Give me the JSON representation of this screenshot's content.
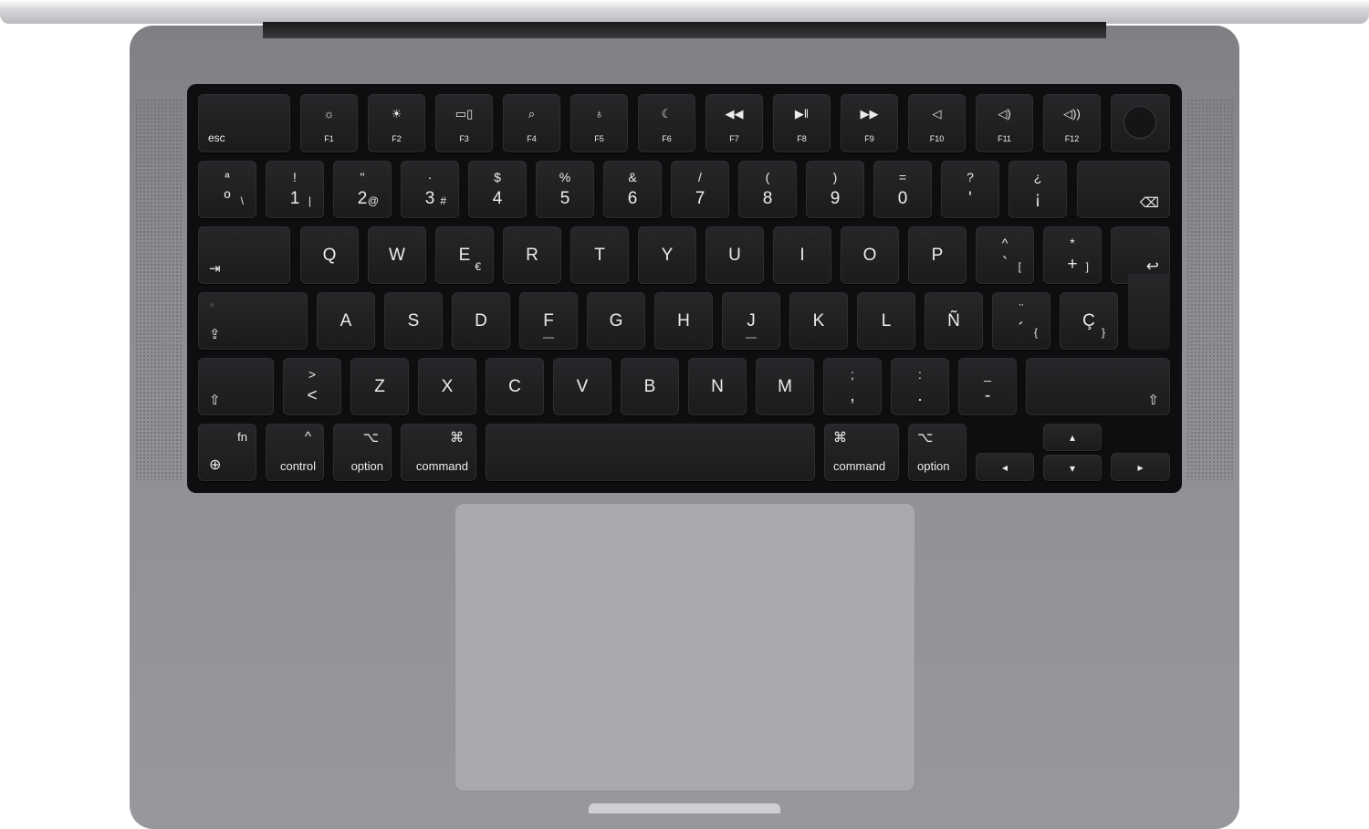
{
  "colors": {
    "chassis": "#8c8d91",
    "keyboard_well": "#0e0e10",
    "key": "#1c1c1e",
    "legend": "#ececec",
    "trackpad": "#a9aaad"
  },
  "keyboard": {
    "rows": [
      {
        "keys": [
          {
            "label": "esc"
          },
          {
            "label": "F1",
            "icon": "brightness-down-icon"
          },
          {
            "label": "F2",
            "icon": "brightness-up-icon"
          },
          {
            "label": "F3",
            "icon": "mission-control-icon"
          },
          {
            "label": "F4",
            "icon": "search-icon"
          },
          {
            "label": "F5",
            "icon": "microphone-icon"
          },
          {
            "label": "F6",
            "icon": "moon-icon"
          },
          {
            "label": "F7",
            "icon": "rewind-icon"
          },
          {
            "label": "F8",
            "icon": "play-pause-icon"
          },
          {
            "label": "F9",
            "icon": "fast-forward-icon"
          },
          {
            "label": "F10",
            "icon": "mute-icon"
          },
          {
            "label": "F11",
            "icon": "volume-down-icon"
          },
          {
            "label": "F12",
            "icon": "volume-up-icon"
          },
          {
            "label": "",
            "icon": "touch-id-icon"
          }
        ]
      },
      {
        "keys": [
          {
            "shift": "ª",
            "label": "º",
            "alt": "\\"
          },
          {
            "shift": "!",
            "label": "1",
            "alt": "|"
          },
          {
            "shift": "\"",
            "label": "2",
            "alt": "@"
          },
          {
            "shift": "·",
            "label": "3",
            "alt": "#"
          },
          {
            "shift": "$",
            "label": "4"
          },
          {
            "shift": "%",
            "label": "5"
          },
          {
            "shift": "&",
            "label": "6"
          },
          {
            "shift": "/",
            "label": "7"
          },
          {
            "shift": "(",
            "label": "8"
          },
          {
            "shift": ")",
            "label": "9"
          },
          {
            "shift": "=",
            "label": "0"
          },
          {
            "shift": "?",
            "label": "'"
          },
          {
            "shift": "¿",
            "label": "¡"
          },
          {
            "label": "",
            "icon": "delete-icon"
          }
        ]
      },
      {
        "keys": [
          {
            "label": "",
            "icon": "tab-icon"
          },
          {
            "label": "Q"
          },
          {
            "label": "W"
          },
          {
            "label": "E",
            "alt": "€"
          },
          {
            "label": "R"
          },
          {
            "label": "T"
          },
          {
            "label": "Y"
          },
          {
            "label": "U"
          },
          {
            "label": "I"
          },
          {
            "label": "O"
          },
          {
            "label": "P"
          },
          {
            "shift": "^",
            "label": "`",
            "alt": "["
          },
          {
            "shift": "*",
            "label": "+",
            "alt": "]"
          }
        ]
      },
      {
        "keys": [
          {
            "label": "",
            "icon": "caps-lock-icon"
          },
          {
            "label": "A"
          },
          {
            "label": "S"
          },
          {
            "label": "D"
          },
          {
            "label": "F"
          },
          {
            "label": "G"
          },
          {
            "label": "H"
          },
          {
            "label": "J"
          },
          {
            "label": "K"
          },
          {
            "label": "L"
          },
          {
            "label": "Ñ"
          },
          {
            "shift": "¨",
            "label": "´",
            "alt": "{"
          },
          {
            "label": "Ç",
            "alt": "}"
          }
        ]
      },
      {
        "keys": [
          {
            "label": "",
            "icon": "shift-icon"
          },
          {
            "shift": ">",
            "label": "<"
          },
          {
            "label": "Z"
          },
          {
            "label": "X"
          },
          {
            "label": "C"
          },
          {
            "label": "V"
          },
          {
            "label": "B"
          },
          {
            "label": "N"
          },
          {
            "label": "M"
          },
          {
            "shift": ";",
            "label": ","
          },
          {
            "shift": ":",
            "label": "."
          },
          {
            "shift": "_",
            "label": "-"
          },
          {
            "label": "",
            "icon": "shift-icon"
          }
        ]
      },
      {
        "keys": [
          {
            "label": "fn",
            "icon": "globe-icon"
          },
          {
            "label": "control",
            "icon": "control-icon"
          },
          {
            "label": "option",
            "icon": "option-icon"
          },
          {
            "label": "command",
            "icon": "command-icon"
          },
          {
            "label": ""
          },
          {
            "label": "command",
            "icon": "command-icon"
          },
          {
            "label": "option",
            "icon": "option-icon"
          },
          {
            "label": "",
            "icon": "arrow-left-icon"
          },
          {
            "label": "",
            "icon": "arrow-up-icon"
          },
          {
            "label": "",
            "icon": "arrow-down-icon"
          },
          {
            "label": "",
            "icon": "arrow-right-icon"
          }
        ]
      }
    ],
    "return_icon": "return-icon"
  }
}
